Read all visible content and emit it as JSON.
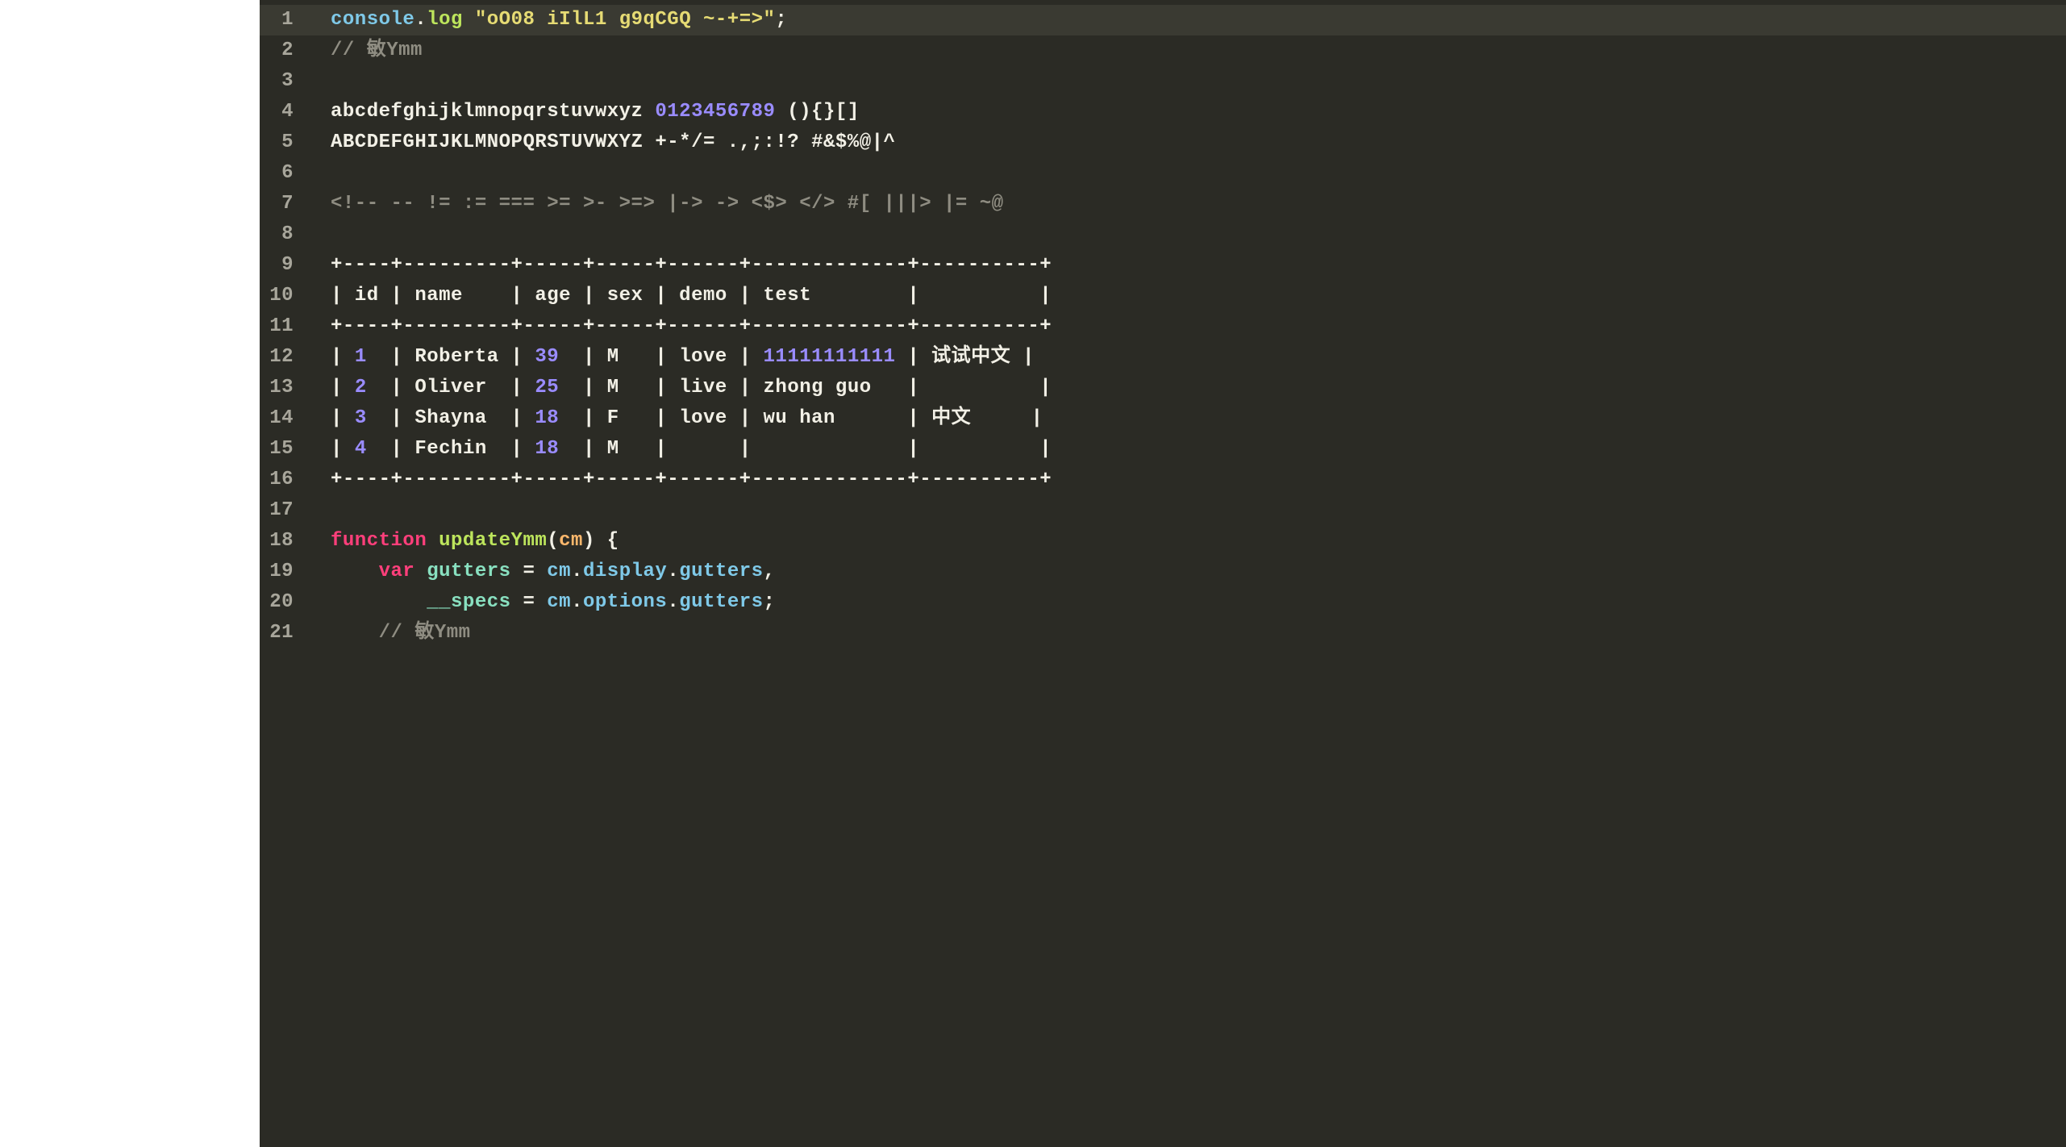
{
  "editor": {
    "currentLine": 1,
    "lines": [
      {
        "n": 1,
        "tokens": [
          {
            "c": "tok-obj",
            "t": "console"
          },
          {
            "c": "tok-punc",
            "t": "."
          },
          {
            "c": "tok-prop",
            "t": "log"
          },
          {
            "c": "tok-punc",
            "t": " "
          },
          {
            "c": "tok-quote",
            "t": "\"oO08 iIlL1 g9qCGQ ~-+=>\""
          },
          {
            "c": "tok-punc",
            "t": ";"
          }
        ]
      },
      {
        "n": 2,
        "tokens": [
          {
            "c": "tok-comment",
            "t": "// 敏Ymm"
          }
        ]
      },
      {
        "n": 3,
        "tokens": []
      },
      {
        "n": 4,
        "tokens": [
          {
            "c": "tok-plain",
            "t": "abcdefghijklmnopqrstuvwxyz "
          },
          {
            "c": "tok-num",
            "t": "0123456789"
          },
          {
            "c": "tok-plain",
            "t": " (){}[]"
          }
        ]
      },
      {
        "n": 5,
        "tokens": [
          {
            "c": "tok-plain",
            "t": "ABCDEFGHIJKLMNOPQRSTUVWXYZ +-*/= .,;:!? #&$%@|^"
          }
        ]
      },
      {
        "n": 6,
        "tokens": []
      },
      {
        "n": 7,
        "tokens": [
          {
            "c": "tok-comment",
            "t": "<!-- -- != := === >= >- >=> |-> -> <$> </> #[ |||> |= ~@"
          }
        ]
      },
      {
        "n": 8,
        "tokens": []
      },
      {
        "n": 9,
        "tokens": [
          {
            "c": "tok-plain",
            "t": "+----+---------+-----+-----+------+-------------+----------+"
          }
        ]
      },
      {
        "n": 10,
        "tokens": [
          {
            "c": "tok-plain",
            "t": "| id | name    | age | sex | demo | test        |          |"
          }
        ]
      },
      {
        "n": 11,
        "tokens": [
          {
            "c": "tok-plain",
            "t": "+----+---------+-----+-----+------+-------------+----------+"
          }
        ]
      },
      {
        "n": 12,
        "tokens": [
          {
            "c": "tok-plain",
            "t": "| "
          },
          {
            "c": "tok-num",
            "t": "1"
          },
          {
            "c": "tok-plain",
            "t": "  | Roberta | "
          },
          {
            "c": "tok-num",
            "t": "39"
          },
          {
            "c": "tok-plain",
            "t": "  | M   | love | "
          },
          {
            "c": "tok-num",
            "t": "11111111111"
          },
          {
            "c": "tok-plain",
            "t": " | 试试中文 |"
          }
        ]
      },
      {
        "n": 13,
        "tokens": [
          {
            "c": "tok-plain",
            "t": "| "
          },
          {
            "c": "tok-num",
            "t": "2"
          },
          {
            "c": "tok-plain",
            "t": "  | Oliver  | "
          },
          {
            "c": "tok-num",
            "t": "25"
          },
          {
            "c": "tok-plain",
            "t": "  | M   | live | zhong guo   |          |"
          }
        ]
      },
      {
        "n": 14,
        "tokens": [
          {
            "c": "tok-plain",
            "t": "| "
          },
          {
            "c": "tok-num",
            "t": "3"
          },
          {
            "c": "tok-plain",
            "t": "  | Shayna  | "
          },
          {
            "c": "tok-num",
            "t": "18"
          },
          {
            "c": "tok-plain",
            "t": "  | F   | love | wu han      | 中文     |"
          }
        ]
      },
      {
        "n": 15,
        "tokens": [
          {
            "c": "tok-plain",
            "t": "| "
          },
          {
            "c": "tok-num",
            "t": "4"
          },
          {
            "c": "tok-plain",
            "t": "  | Fechin  | "
          },
          {
            "c": "tok-num",
            "t": "18"
          },
          {
            "c": "tok-plain",
            "t": "  | M   |      |             |          |"
          }
        ]
      },
      {
        "n": 16,
        "tokens": [
          {
            "c": "tok-plain",
            "t": "+----+---------+-----+-----+------+-------------+----------+"
          }
        ]
      },
      {
        "n": 17,
        "tokens": []
      },
      {
        "n": 18,
        "tokens": [
          {
            "c": "tok-key",
            "t": "function"
          },
          {
            "c": "tok-plain",
            "t": " "
          },
          {
            "c": "tok-fn",
            "t": "updateYmm"
          },
          {
            "c": "tok-punc",
            "t": "("
          },
          {
            "c": "tok-param",
            "t": "cm"
          },
          {
            "c": "tok-punc",
            "t": ") {"
          }
        ]
      },
      {
        "n": 19,
        "tokens": [
          {
            "c": "tok-plain",
            "t": "    "
          },
          {
            "c": "tok-key",
            "t": "var"
          },
          {
            "c": "tok-plain",
            "t": " "
          },
          {
            "c": "tok-var",
            "t": "gutters"
          },
          {
            "c": "tok-plain",
            "t": " = "
          },
          {
            "c": "tok-obj",
            "t": "cm"
          },
          {
            "c": "tok-punc",
            "t": "."
          },
          {
            "c": "tok-obj",
            "t": "display"
          },
          {
            "c": "tok-punc",
            "t": "."
          },
          {
            "c": "tok-obj",
            "t": "gutters"
          },
          {
            "c": "tok-punc",
            "t": ","
          }
        ]
      },
      {
        "n": 20,
        "tokens": [
          {
            "c": "tok-plain",
            "t": "        "
          },
          {
            "c": "tok-var",
            "t": "__specs"
          },
          {
            "c": "tok-plain",
            "t": " = "
          },
          {
            "c": "tok-obj",
            "t": "cm"
          },
          {
            "c": "tok-punc",
            "t": "."
          },
          {
            "c": "tok-obj",
            "t": "options"
          },
          {
            "c": "tok-punc",
            "t": "."
          },
          {
            "c": "tok-obj",
            "t": "gutters"
          },
          {
            "c": "tok-punc",
            "t": ";"
          }
        ]
      },
      {
        "n": 21,
        "tokens": [
          {
            "c": "tok-plain",
            "t": "    "
          },
          {
            "c": "tok-comment",
            "t": "// 敏Ymm"
          }
        ]
      }
    ]
  }
}
